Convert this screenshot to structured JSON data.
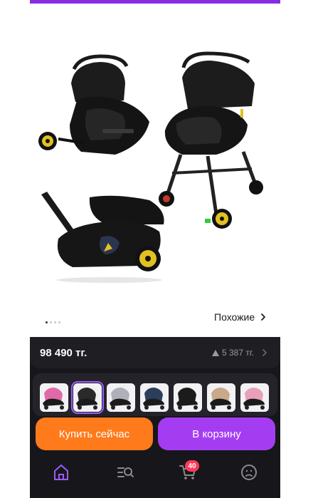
{
  "product": {
    "price": "98 490 тг.",
    "rating_change": "5 387 тг."
  },
  "gallery": {
    "similar_label": "Похожие",
    "dots_count": 4,
    "active_dot": 0
  },
  "thumbnails": [
    {
      "accent": "#e06aa8"
    },
    {
      "accent": "#2a2a2a"
    },
    {
      "accent": "#b0b0b8"
    },
    {
      "accent": "#2c3e5a"
    },
    {
      "accent": "#1b1b1b"
    },
    {
      "accent": "#c8a98a"
    },
    {
      "accent": "#e8a0b8"
    }
  ],
  "actions": {
    "buy_now_label": "Купить сейчас",
    "add_to_cart_label": "В корзину"
  },
  "nav": {
    "cart_badge": "40",
    "items": [
      "home-icon",
      "search-list-icon",
      "cart-icon",
      "profile-icon"
    ]
  },
  "colors": {
    "accent_purple": "#a43df2",
    "accent_orange": "#ff7a1a",
    "active_nav": "#9b5cff",
    "badge": "#ff3b5c"
  }
}
